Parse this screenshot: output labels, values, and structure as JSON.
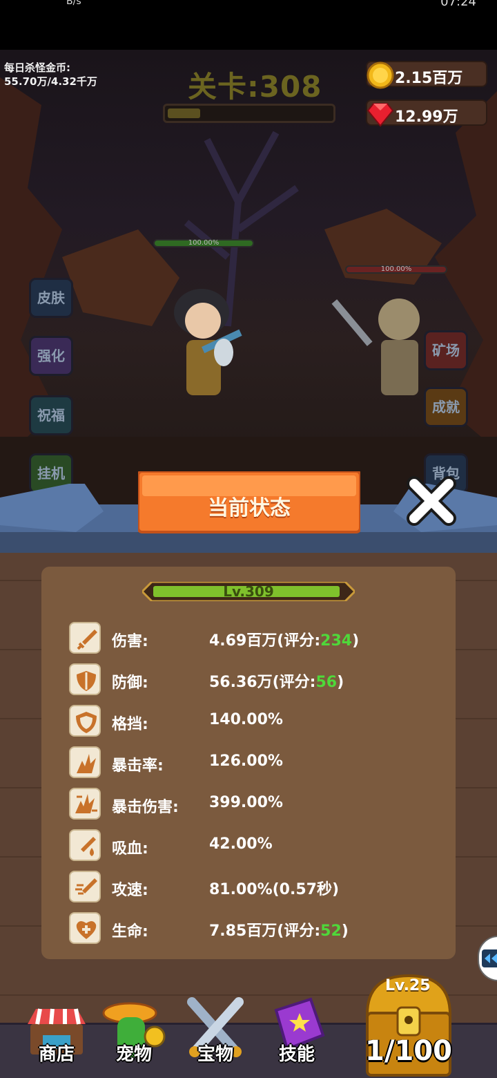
{
  "status_bar": {
    "left_text": "B/s",
    "right_text": "07:24"
  },
  "hud": {
    "kill_gold_label": "每日杀怪金币:",
    "kill_gold_value": "55.70万/4.32千万",
    "stage_title": "关卡:308",
    "stage_progress": 0.2,
    "gold": "2.15百万",
    "gems": "12.99万"
  },
  "combat": {
    "hero_hp": "100.00%",
    "enemy_hp": "100.00%"
  },
  "side_buttons_left": [
    "皮肤",
    "强化",
    "祝福",
    "挂机"
  ],
  "side_buttons_right": [
    "矿场",
    "成就",
    "背包"
  ],
  "modal": {
    "title": "当前状态",
    "level": "Lv.309",
    "stats": [
      {
        "name": "伤害:",
        "value": "4.69百万(评分:",
        "score": "234",
        "suffix": ")",
        "icon": "sword-icon"
      },
      {
        "name": "防御:",
        "value": "56.36万(评分:",
        "score": "56",
        "suffix": ")",
        "icon": "shield-icon"
      },
      {
        "name": "格挡:",
        "value": "140.00%",
        "score": "",
        "suffix": "",
        "icon": "block-shield-icon"
      },
      {
        "name": "暴击率:",
        "value": "126.00%",
        "score": "",
        "suffix": "",
        "icon": "crit-icon"
      },
      {
        "name": "暴击伤害:",
        "value": "399.00%",
        "score": "",
        "suffix": "",
        "icon": "crit-damage-icon"
      },
      {
        "name": "吸血:",
        "value": "42.00%",
        "score": "",
        "suffix": "",
        "icon": "lifesteal-icon"
      },
      {
        "name": "攻速:",
        "value": "81.00%(0.57秒)",
        "score": "",
        "suffix": "",
        "icon": "attack-speed-icon"
      },
      {
        "name": "生命:",
        "value": "7.85百万(评分:",
        "score": "52",
        "suffix": ")",
        "icon": "health-icon"
      }
    ]
  },
  "nav": {
    "shop": "商店",
    "pet": "宠物",
    "treasure": "宝物",
    "skill": "技能",
    "chest_level": "Lv.25",
    "chest_count": "1/100"
  },
  "colors": {
    "score_green": "#4fd83a",
    "panel_brown": "#7b5a3e",
    "banner_orange": "#f57a2c"
  }
}
